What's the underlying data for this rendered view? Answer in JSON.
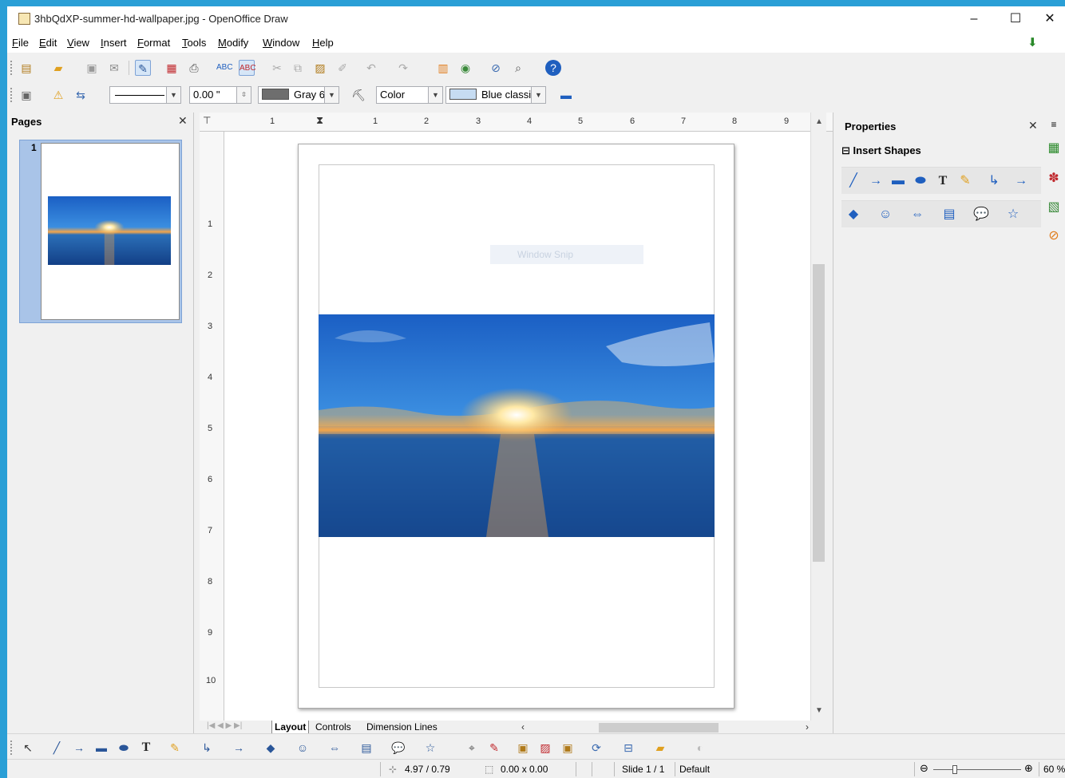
{
  "window": {
    "title": "3hbQdXP-summer-hd-wallpaper.jpg - OpenOffice Draw",
    "minimize": "–",
    "maximize": "☐",
    "close": "✕"
  },
  "menu": [
    {
      "key": "F",
      "rest": "ile"
    },
    {
      "key": "E",
      "rest": "dit"
    },
    {
      "key": "V",
      "rest": "iew"
    },
    {
      "key": "I",
      "rest": "nsert"
    },
    {
      "key": "F",
      "rest": "ormat",
      "prefix": ""
    },
    {
      "key": "T",
      "rest": "ools"
    },
    {
      "key": "M",
      "rest": "odify"
    },
    {
      "key": "W",
      "rest": "indow"
    },
    {
      "key": "H",
      "rest": "elp"
    }
  ],
  "line_toolbar": {
    "line_width": "0.00 \"",
    "line_color_label": "Gray 6",
    "line_color": "#6e6e6e",
    "area_style": "Color",
    "area_color_label": "Blue classic",
    "area_color": "#c6dcf2"
  },
  "pages_panel": {
    "title": "Pages",
    "close": "✕",
    "page_number": "1"
  },
  "ruler": {
    "h_labels": [
      "1",
      "1",
      "2",
      "3",
      "4",
      "5",
      "6",
      "7",
      "8",
      "9"
    ],
    "v_labels": [
      "1",
      "2",
      "3",
      "4",
      "5",
      "6",
      "7",
      "8",
      "9",
      "10"
    ]
  },
  "canvas": {
    "ghost_text": "Window Snip"
  },
  "tabs": {
    "layout": "Layout",
    "controls": "Controls",
    "dimension_lines": "Dimension Lines"
  },
  "properties": {
    "title": "Properties",
    "close": "✕",
    "section": "Insert Shapes",
    "collapse": "⊟"
  },
  "status": {
    "position": "4.97 / 0.79",
    "size": "0.00 x 0.00",
    "slide": "Slide 1 / 1",
    "master": "Default",
    "zoom": "60 %"
  },
  "colors": {
    "accent": "#2a9fd6",
    "selection": "#a9c4e8",
    "sky_top": "#1a5fc0",
    "sea": "#1a4f96"
  }
}
